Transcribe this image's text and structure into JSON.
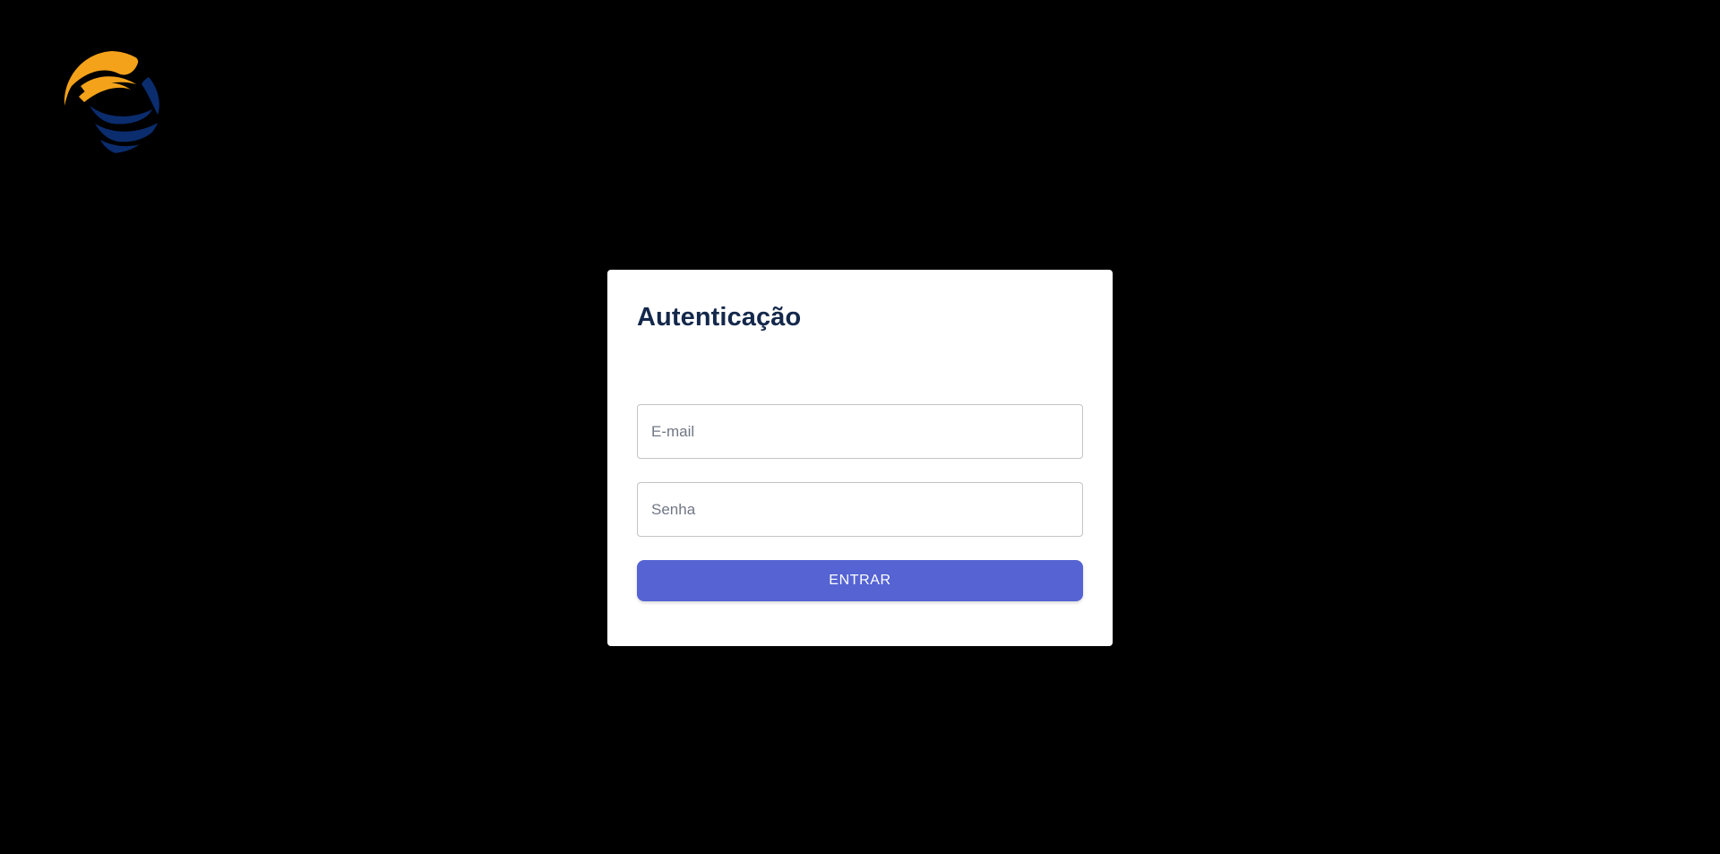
{
  "logo": {
    "icon": "brand-wave-logo",
    "colors": {
      "orange": "#f39c12",
      "navy": "#0b2d6e"
    }
  },
  "login": {
    "title": "Autenticação",
    "email_placeholder": "E-mail",
    "email_value": "",
    "password_placeholder": "Senha",
    "password_value": "",
    "submit_label": "ENTRAR"
  },
  "colors": {
    "background": "#000000",
    "card": "#ffffff",
    "title": "#14284b",
    "button": "#5563d3"
  }
}
